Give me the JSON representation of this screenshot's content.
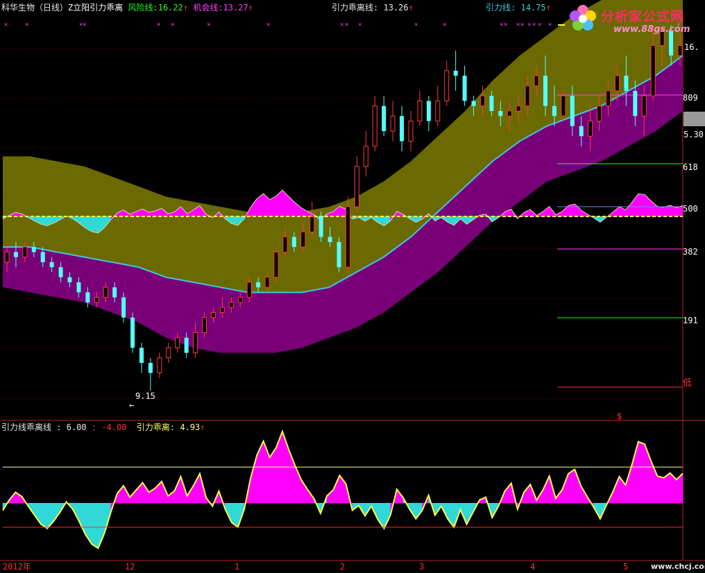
{
  "header": {
    "stock": "科华生物（日线）",
    "indicator": "Z立阳引力乖离",
    "risk_label": "风险线:",
    "risk_value": "16.22",
    "chance_label": "机会线:",
    "chance_value": "13.27",
    "dev_label": "引力乖离线:",
    "dev_value": "13.26",
    "grav_label": "引力线:",
    "grav_value": "14.75",
    "arrow": "↑"
  },
  "logo": {
    "text": "分析家公式网",
    "url": "www.88gs.com"
  },
  "sub_header": {
    "label": "引力线乖离线",
    "sep1": ":",
    "v1": "6.00",
    "sep2": ":",
    "v2": "-4.00",
    "label2": "引力乖离:",
    "v3": "4.93",
    "arrow": "↑"
  },
  "price_labels": {
    "top": "16.",
    "low": "9.15",
    "low_arrow": "←",
    "current": "5.30",
    "dollar": "$"
  },
  "fib_labels": [
    "809",
    "618",
    "500",
    "382",
    "191",
    "低"
  ],
  "x_axis": [
    "2012年",
    "12",
    "1",
    "2",
    "3",
    "4",
    "5"
  ],
  "watermark": "www.chcj.com",
  "colors": {
    "up": "#ff3b3b",
    "down": "#54ffff",
    "upper_band": "#6b6a00",
    "lower_band": "#7a007a",
    "gravity": "#40c8e0",
    "magenta": "#ff00ff",
    "cyan": "#30d8d8",
    "yellow": "#ffff40"
  },
  "chart_data": [
    {
      "type": "candlestick",
      "title": "科华生物（日线）",
      "y_range": [
        8.6,
        16.6
      ],
      "low_marker": 9.15,
      "bands": [
        {
          "name": "风险线",
          "values": [
            13.8,
            13.8,
            13.7,
            13.6,
            13.4,
            13.2,
            13.0,
            12.9,
            12.8,
            12.7,
            12.7,
            12.7,
            12.8,
            13.0,
            13.3,
            13.7,
            14.2,
            14.7,
            15.3,
            15.8,
            16.2,
            16.6,
            16.9,
            17.3,
            17.7,
            18.2
          ]
        },
        {
          "name": "引力线",
          "values": [
            12.0,
            12.0,
            11.9,
            11.8,
            11.7,
            11.6,
            11.4,
            11.3,
            11.2,
            11.1,
            11.1,
            11.1,
            11.2,
            11.5,
            11.8,
            12.2,
            12.7,
            13.2,
            13.7,
            14.1,
            14.4,
            14.6,
            14.8,
            15.1,
            15.4,
            15.8
          ]
        },
        {
          "name": "机会线",
          "values": [
            11.2,
            11.1,
            11.0,
            10.9,
            10.7,
            10.5,
            10.2,
            10.0,
            9.9,
            9.9,
            9.9,
            10.0,
            10.2,
            10.4,
            10.7,
            11.1,
            11.5,
            12.0,
            12.5,
            12.9,
            13.3,
            13.5,
            13.7,
            14.0,
            14.3,
            14.7
          ]
        }
      ],
      "candles": [
        [
          11.7,
          11.9,
          11.5,
          12.0
        ],
        [
          11.9,
          11.8,
          11.6,
          12.1
        ],
        [
          11.8,
          12.0,
          11.7,
          12.1
        ],
        [
          12.0,
          11.9,
          11.8,
          12.1
        ],
        [
          11.9,
          11.7,
          11.6,
          12.0
        ],
        [
          11.7,
          11.6,
          11.5,
          11.8
        ],
        [
          11.6,
          11.4,
          11.3,
          11.7
        ],
        [
          11.4,
          11.3,
          11.2,
          11.5
        ],
        [
          11.3,
          11.1,
          11.0,
          11.4
        ],
        [
          11.1,
          10.9,
          10.8,
          11.2
        ],
        [
          10.9,
          11.0,
          10.8,
          11.1
        ],
        [
          11.0,
          11.2,
          10.9,
          11.3
        ],
        [
          11.2,
          11.0,
          10.9,
          11.3
        ],
        [
          11.0,
          10.6,
          10.5,
          11.1
        ],
        [
          10.6,
          10.0,
          9.9,
          10.7
        ],
        [
          10.0,
          9.7,
          9.5,
          10.1
        ],
        [
          9.7,
          9.5,
          9.15,
          9.8
        ],
        [
          9.5,
          9.8,
          9.4,
          9.9
        ],
        [
          9.8,
          10.0,
          9.7,
          10.1
        ],
        [
          10.0,
          10.2,
          9.9,
          10.3
        ],
        [
          10.2,
          9.9,
          9.8,
          10.3
        ],
        [
          9.9,
          10.3,
          9.8,
          10.5
        ],
        [
          10.3,
          10.6,
          10.2,
          10.7
        ],
        [
          10.6,
          10.7,
          10.5,
          10.8
        ],
        [
          10.7,
          10.8,
          10.6,
          11.0
        ],
        [
          10.8,
          10.9,
          10.7,
          11.0
        ],
        [
          10.9,
          11.0,
          10.8,
          11.1
        ],
        [
          11.0,
          11.3,
          10.9,
          11.4
        ],
        [
          11.3,
          11.2,
          11.1,
          11.4
        ],
        [
          11.2,
          11.4,
          11.1,
          11.5
        ],
        [
          11.4,
          11.9,
          11.3,
          12.0
        ],
        [
          11.9,
          12.2,
          11.8,
          12.4
        ],
        [
          12.2,
          12.0,
          11.9,
          12.3
        ],
        [
          12.0,
          12.3,
          11.9,
          12.5
        ],
        [
          12.3,
          12.6,
          12.2,
          12.9
        ],
        [
          12.6,
          12.2,
          12.1,
          12.7
        ],
        [
          12.2,
          12.1,
          12.0,
          12.4
        ],
        [
          12.1,
          11.6,
          11.5,
          12.2
        ],
        [
          11.6,
          12.8,
          11.5,
          13.0
        ],
        [
          12.8,
          13.6,
          12.7,
          13.8
        ],
        [
          13.6,
          14.0,
          13.4,
          14.3
        ],
        [
          14.0,
          14.8,
          13.9,
          15.0
        ],
        [
          14.8,
          14.3,
          14.2,
          15.0
        ],
        [
          14.3,
          14.6,
          14.1,
          14.9
        ],
        [
          14.6,
          14.1,
          13.9,
          14.8
        ],
        [
          14.1,
          14.5,
          13.9,
          14.7
        ],
        [
          14.5,
          14.9,
          14.4,
          15.1
        ],
        [
          14.9,
          14.5,
          14.3,
          15.0
        ],
        [
          14.5,
          14.9,
          14.4,
          15.2
        ],
        [
          14.9,
          15.5,
          14.8,
          15.7
        ],
        [
          15.5,
          15.4,
          15.1,
          15.9
        ],
        [
          15.4,
          14.9,
          14.8,
          15.6
        ],
        [
          14.9,
          14.8,
          14.6,
          15.0
        ],
        [
          14.8,
          15.0,
          14.6,
          15.2
        ],
        [
          15.0,
          14.7,
          14.6,
          15.1
        ],
        [
          14.7,
          14.6,
          14.4,
          14.9
        ],
        [
          14.6,
          14.7,
          14.3,
          14.9
        ],
        [
          14.7,
          14.8,
          14.4,
          15.0
        ],
        [
          14.8,
          15.2,
          14.6,
          15.4
        ],
        [
          15.2,
          15.4,
          15.0,
          15.6
        ],
        [
          15.4,
          14.8,
          14.6,
          15.8
        ],
        [
          14.8,
          14.6,
          14.4,
          15.2
        ],
        [
          14.6,
          15.0,
          14.5,
          15.1
        ],
        [
          15.0,
          14.4,
          14.2,
          15.2
        ],
        [
          14.4,
          14.2,
          14.0,
          14.6
        ],
        [
          14.2,
          14.5,
          13.9,
          14.8
        ],
        [
          14.5,
          14.8,
          14.3,
          15.0
        ],
        [
          14.8,
          15.1,
          14.6,
          15.3
        ],
        [
          15.1,
          15.4,
          14.9,
          15.6
        ],
        [
          15.4,
          15.1,
          14.8,
          15.8
        ],
        [
          15.1,
          14.6,
          14.4,
          15.3
        ],
        [
          14.6,
          15.0,
          14.2,
          15.2
        ],
        [
          15.0,
          16.0,
          14.9,
          16.4
        ],
        [
          16.0,
          16.3,
          15.6,
          16.4
        ],
        [
          16.3,
          15.8,
          15.6,
          16.4
        ],
        [
          15.8,
          16.0,
          15.6,
          16.2
        ]
      ]
    },
    {
      "type": "area",
      "title": "引力线乖离线",
      "y_range": [
        -9.3,
        11.9
      ],
      "reference_lines": [
        6.0,
        -4.0,
        0
      ],
      "current": 4.93,
      "values": [
        -1.2,
        0.5,
        1.8,
        1.1,
        -0.5,
        -2.0,
        -3.5,
        -4.2,
        -3.0,
        -1.5,
        0.2,
        -1.0,
        -3.0,
        -5.2,
        -6.8,
        -7.5,
        -5.0,
        -1.5,
        1.6,
        2.9,
        1.0,
        2.2,
        3.4,
        1.8,
        2.5,
        3.6,
        1.2,
        2.0,
        4.4,
        1.2,
        2.9,
        4.9,
        0.9,
        -0.5,
        2.0,
        -1.0,
        -3.2,
        -4.0,
        -1.0,
        4.2,
        8.0,
        10.3,
        7.6,
        9.2,
        11.9,
        8.9,
        6.2,
        3.8,
        2.2,
        0.7,
        -1.7,
        1.2,
        2.2,
        4.6,
        3.2,
        -1.2,
        -0.4,
        -2.1,
        -0.5,
        -2.7,
        -4.2,
        -2.0,
        2.3,
        0.9,
        -1.0,
        -2.6,
        -1.2,
        1.3,
        -2.0,
        -0.5,
        -2.6,
        -4.0,
        -1.1,
        -3.5,
        -1.5,
        0.5,
        1.0,
        -2.4,
        -0.5,
        2.0,
        3.3,
        -1.0,
        1.8,
        3.1,
        0.5,
        2.2,
        4.5,
        0.8,
        2.2,
        4.9,
        5.6,
        2.8,
        1.0,
        -0.7,
        -2.6,
        -0.3,
        1.9,
        4.4,
        3.0,
        6.4,
        10.2,
        9.8,
        7.0,
        4.5,
        4.2,
        5.0,
        3.9,
        4.93
      ]
    }
  ]
}
